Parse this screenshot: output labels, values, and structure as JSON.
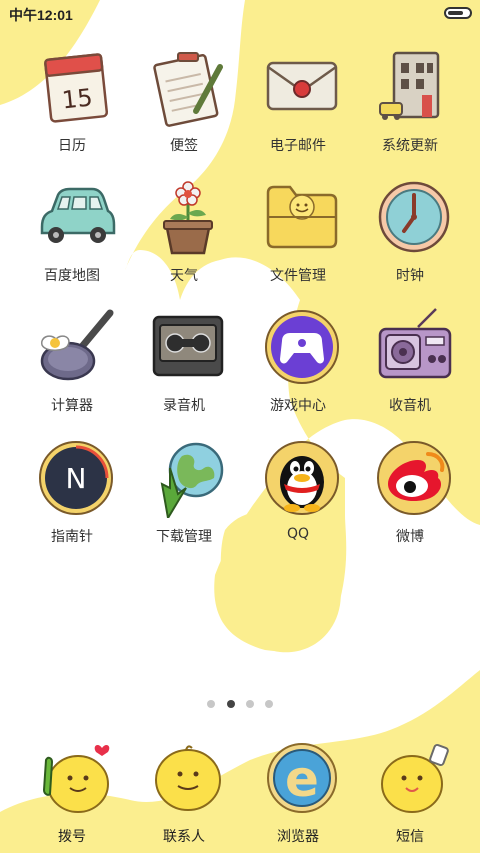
{
  "status_bar": {
    "time": "中午12:01",
    "battery_level": 0.75
  },
  "pages": {
    "count": 4,
    "active_index": 1
  },
  "apps": [
    {
      "label": "日历",
      "icon": "calendar-icon",
      "date": "15"
    },
    {
      "label": "便签",
      "icon": "notepad-icon"
    },
    {
      "label": "电子邮件",
      "icon": "envelope-icon"
    },
    {
      "label": "系统更新",
      "icon": "building-icon"
    },
    {
      "label": "百度地图",
      "icon": "car-icon"
    },
    {
      "label": "天气",
      "icon": "flowerpot-icon"
    },
    {
      "label": "文件管理",
      "icon": "folder-icon"
    },
    {
      "label": "时钟",
      "icon": "clock-icon"
    },
    {
      "label": "计算器",
      "icon": "frying-pan-icon"
    },
    {
      "label": "录音机",
      "icon": "cassette-icon"
    },
    {
      "label": "游戏中心",
      "icon": "gamepad-icon"
    },
    {
      "label": "收音机",
      "icon": "radio-icon"
    },
    {
      "label": "指南针",
      "icon": "compass-icon",
      "glyph": "N"
    },
    {
      "label": "下载管理",
      "icon": "globe-download-icon"
    },
    {
      "label": "QQ",
      "icon": "penguin-icon"
    },
    {
      "label": "微博",
      "icon": "weibo-icon"
    }
  ],
  "dock": [
    {
      "label": "拨号",
      "icon": "phone-chick-icon"
    },
    {
      "label": "联系人",
      "icon": "chick-icon"
    },
    {
      "label": "浏览器",
      "icon": "browser-e-icon",
      "glyph": "e"
    },
    {
      "label": "短信",
      "icon": "message-chick-icon"
    }
  ],
  "colors": {
    "wallpaper_yellow": "#fbee8f",
    "label_text": "#333333"
  }
}
